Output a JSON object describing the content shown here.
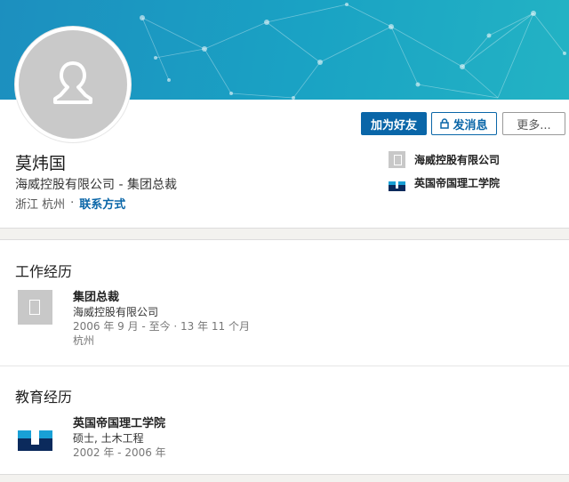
{
  "profile": {
    "name": "莫炜国",
    "headline": "海威控股有限公司 - 集团总裁",
    "location": "浙江 杭州",
    "separator": "·",
    "contact_link": "联系方式"
  },
  "actions": {
    "connect": "加为好友",
    "message": "发消息",
    "more": "更多..."
  },
  "sidebar": {
    "company": "海威控股有限公司",
    "school": "英国帝国理工学院"
  },
  "experience": {
    "title": "工作经历",
    "items": [
      {
        "role": "集团总裁",
        "company": "海威控股有限公司",
        "dates": "2006 年 9 月 - 至今 · 13 年 11 个月",
        "location": "杭州"
      }
    ]
  },
  "education": {
    "title": "教育经历",
    "items": [
      {
        "school": "英国帝国理工学院",
        "degree": "硕士, 土木工程",
        "dates": "2002 年 - 2006 年"
      }
    ]
  },
  "colors": {
    "accent": "#0a66a8",
    "banner_start": "#1c8fbf",
    "banner_end": "#23b3c4"
  }
}
